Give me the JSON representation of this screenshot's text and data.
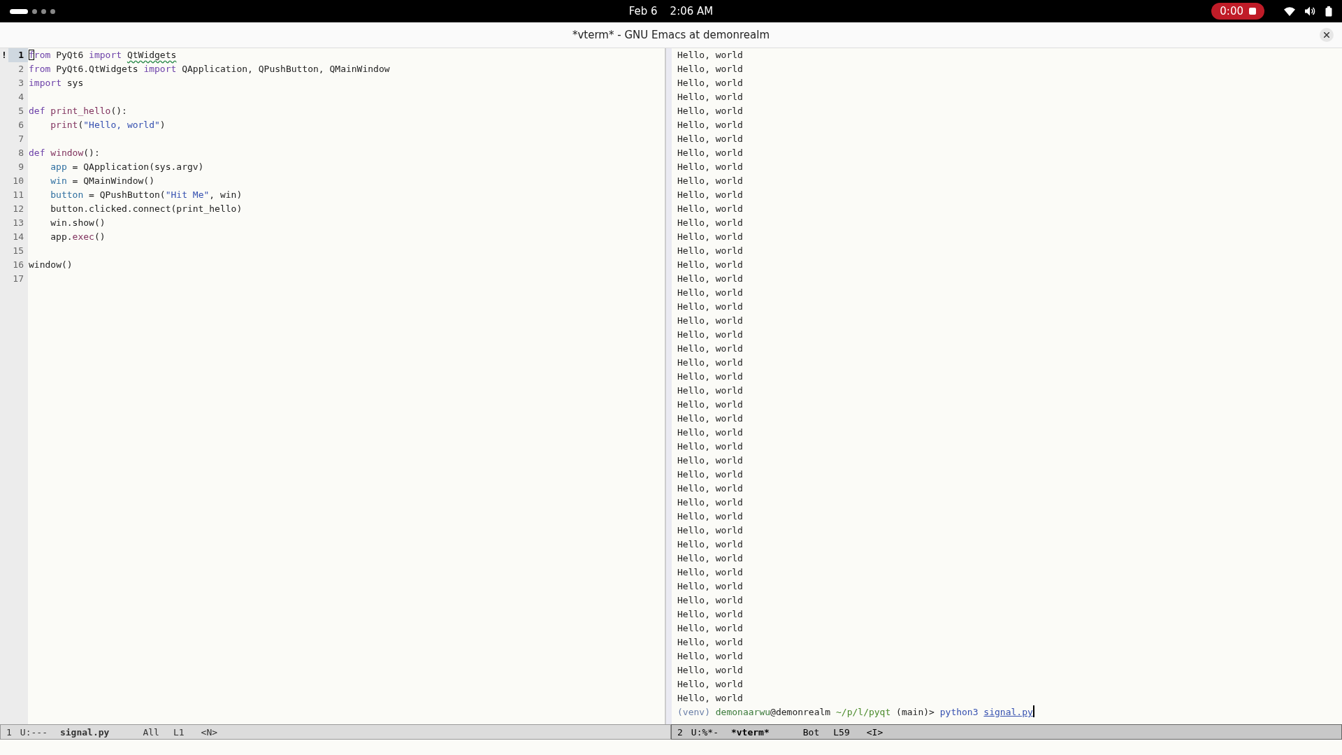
{
  "top_bar": {
    "workspaces": [
      {
        "selected": true
      },
      {
        "selected": false
      },
      {
        "selected": false
      },
      {
        "selected": false
      }
    ],
    "date": "Feb 6",
    "time": "2:06 AM",
    "recording": {
      "time": "0:00"
    }
  },
  "title_bar": {
    "title": "*vterm* - GNU Emacs at demonrealm"
  },
  "editor": {
    "fringe_marker": "!",
    "lines": [
      {
        "number": "1",
        "current": true,
        "segments": [
          {
            "text": "f",
            "kind": "keyword",
            "cursor": true
          },
          {
            "text": "rom",
            "kind": "keyword"
          },
          {
            "text": " PyQt6 ",
            "kind": "plain"
          },
          {
            "text": "import ",
            "kind": "keyword"
          },
          {
            "text": "QtWidgets",
            "kind": "warning"
          }
        ]
      },
      {
        "number": "2",
        "current": false,
        "segments": [
          {
            "text": "from",
            "kind": "keyword"
          },
          {
            "text": " PyQt6.QtWidgets ",
            "kind": "plain"
          },
          {
            "text": "import",
            "kind": "keyword"
          },
          {
            "text": " QApplication, QPushButton, QMainWindow",
            "kind": "plain"
          }
        ]
      },
      {
        "number": "3",
        "current": false,
        "segments": [
          {
            "text": "import",
            "kind": "keyword"
          },
          {
            "text": " sys",
            "kind": "plain"
          }
        ]
      },
      {
        "number": "4",
        "current": false
      },
      {
        "number": "5",
        "current": false,
        "segments": [
          {
            "text": "def ",
            "kind": "keyword"
          },
          {
            "text": "print_hello",
            "kind": "function"
          },
          {
            "text": "():",
            "kind": "plain"
          }
        ]
      },
      {
        "number": "6",
        "current": false,
        "indented": true,
        "segments": [
          {
            "text": "print",
            "kind": "function"
          },
          {
            "text": "(",
            "kind": "plain"
          },
          {
            "text": "\"Hello, world\"",
            "kind": "string"
          },
          {
            "text": ")",
            "kind": "plain"
          }
        ]
      },
      {
        "number": "7",
        "current": false
      },
      {
        "number": "8",
        "current": false,
        "segments": [
          {
            "text": "def ",
            "kind": "keyword"
          },
          {
            "text": "window",
            "kind": "function"
          },
          {
            "text": "():",
            "kind": "plain"
          }
        ]
      },
      {
        "number": "9",
        "current": false,
        "indented": true,
        "segments": [
          {
            "text": "app",
            "kind": "variable"
          },
          {
            "text": " = QApplication(sys.argv)",
            "kind": "plain"
          }
        ]
      },
      {
        "number": "10",
        "current": false,
        "indented": true,
        "segments": [
          {
            "text": "win",
            "kind": "variable"
          },
          {
            "text": " = QMainWindow()",
            "kind": "plain"
          }
        ]
      },
      {
        "number": "11",
        "current": false,
        "indented": true,
        "segments": [
          {
            "text": "button",
            "kind": "variable"
          },
          {
            "text": " = QPushButton(",
            "kind": "plain"
          },
          {
            "text": "\"Hit Me\"",
            "kind": "string"
          },
          {
            "text": ", win)",
            "kind": "plain"
          }
        ]
      },
      {
        "number": "12",
        "current": false,
        "indented": true,
        "segments": [
          {
            "text": "button.clicked.connect(print_hello)",
            "kind": "plain"
          }
        ]
      },
      {
        "number": "13",
        "current": false,
        "indented": true,
        "segments": [
          {
            "text": "win.show()",
            "kind": "plain"
          }
        ]
      },
      {
        "number": "14",
        "current": false,
        "indented": true,
        "segments": [
          {
            "text": "app.",
            "kind": "plain"
          },
          {
            "text": "exec",
            "kind": "function"
          },
          {
            "text": "()",
            "kind": "plain"
          }
        ]
      },
      {
        "number": "15",
        "current": false
      },
      {
        "number": "16",
        "current": false,
        "segments": [
          {
            "text": "window()",
            "kind": "plain"
          }
        ]
      },
      {
        "number": "17",
        "current": false
      }
    ]
  },
  "left_mode_line": {
    "active": false,
    "window_number": "1",
    "state": "U:---",
    "buffer": "signal.py",
    "position": "All",
    "line": "L1",
    "mode": "<N>"
  },
  "terminal": {
    "output": [
      "Hello, world",
      "Hello, world",
      "Hello, world",
      "Hello, world",
      "Hello, world",
      "Hello, world",
      "Hello, world",
      "Hello, world",
      "Hello, world",
      "Hello, world",
      "Hello, world",
      "Hello, world",
      "Hello, world",
      "Hello, world",
      "Hello, world",
      "Hello, world",
      "Hello, world",
      "Hello, world",
      "Hello, world",
      "Hello, world",
      "Hello, world",
      "Hello, world",
      "Hello, world",
      "Hello, world",
      "Hello, world",
      "Hello, world",
      "Hello, world",
      "Hello, world",
      "Hello, world",
      "Hello, world",
      "Hello, world",
      "Hello, world",
      "Hello, world",
      "Hello, world",
      "Hello, world",
      "Hello, world",
      "Hello, world",
      "Hello, world",
      "Hello, world",
      "Hello, world",
      "Hello, world",
      "Hello, world",
      "Hello, world",
      "Hello, world",
      "Hello, world",
      "Hello, world",
      "Hello, world"
    ],
    "prompt": [
      {
        "text": "(venv) ",
        "kind": "venv"
      },
      {
        "text": "demonaarwu",
        "kind": "user"
      },
      {
        "text": "@demonrealm ",
        "kind": "plain"
      },
      {
        "text": "~/p/l/pyqt",
        "kind": "path"
      },
      {
        "text": " (main)> ",
        "kind": "plain"
      },
      {
        "text": "python3 ",
        "kind": "command"
      },
      {
        "text": "signal.py",
        "kind": "file"
      }
    ]
  },
  "right_mode_line": {
    "active": true,
    "window_number": "2",
    "state": "U:%*-",
    "buffer": "*vterm*",
    "position": "Bot",
    "line": "L59",
    "mode": "<I>"
  }
}
